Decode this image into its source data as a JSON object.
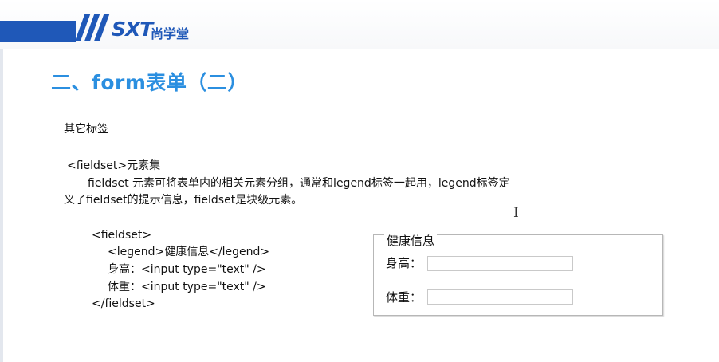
{
  "header": {
    "logo_text": "SXT",
    "logo_cn": "尚学堂",
    "accent_color": "#1f58b8"
  },
  "slide": {
    "title": "二、form表单（二）",
    "title_color": "#2b8fe0",
    "section_heading": "其它标签",
    "element_heading": "<fieldset>元素集",
    "description_line1": "fieldset 元素可将表单内的相关元素分组，通常和legend标签一起用，legend标签定",
    "description_line2": "义了fieldset的提示信息，fieldset是块级元素。"
  },
  "code_sample": {
    "lines": [
      "<fieldset>",
      "<legend>健康信息</legend>",
      "身高：<input type=\"text\" />",
      "体重：<input type=\"text\" />",
      "</fieldset>"
    ]
  },
  "demo": {
    "legend": "健康信息",
    "height_label": "身高：",
    "height_value": "",
    "weight_label": "体重：",
    "weight_value": ""
  },
  "cursor_icon": "text-cursor-icon"
}
